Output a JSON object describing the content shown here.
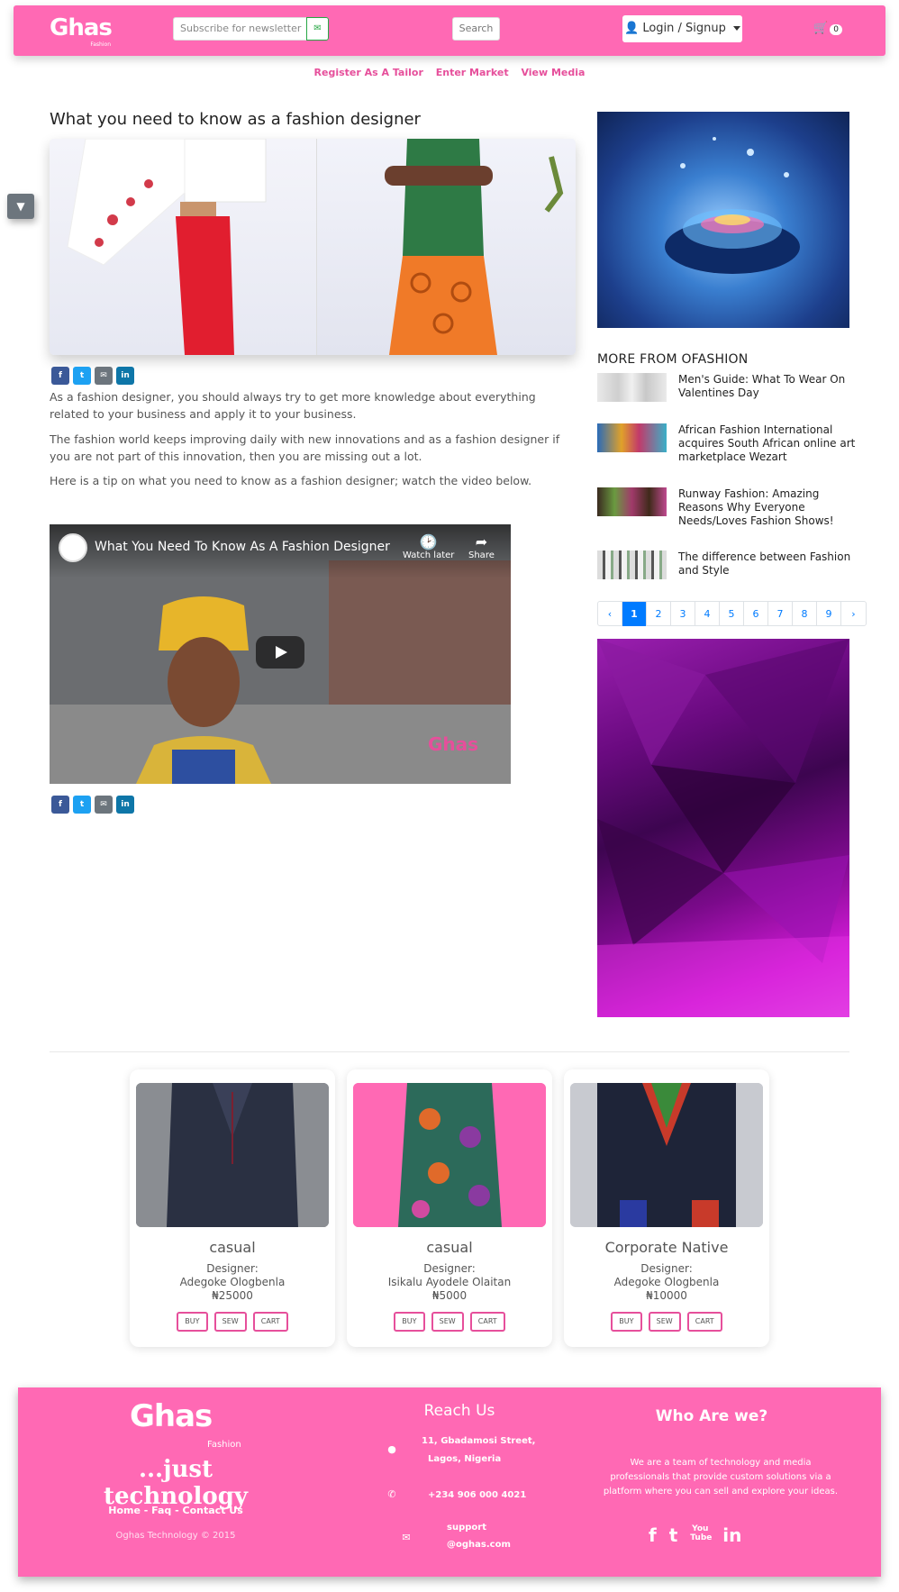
{
  "header": {
    "logo": "Ghas",
    "logo_sub": "Fashion",
    "newsletter_placeholder": "Subscribe for newsletter",
    "newsletter_icon": "envelope-icon",
    "search_label": "Search",
    "login_label": "Login / Signup",
    "cart_count": "0"
  },
  "topnav": [
    "Register As A Tailor",
    "Enter Market",
    "View Media"
  ],
  "article": {
    "title": "What you need to know as a fashion designer",
    "share": [
      "f",
      "t",
      "✉",
      "in"
    ],
    "paragraphs": [
      "As a fashion designer, you should always try to get more knowledge about everything related to your business and apply it to your business.",
      "The fashion world keeps improving daily with new innovations and as a fashion designer if you are not part of this innovation, then you are missing out a lot.",
      "Here is a tip on what you need to know as a fashion designer; watch the video below."
    ],
    "video": {
      "title": "What You Need To Know As A Fashion Designer",
      "watch_later": "Watch later",
      "share": "Share",
      "watermark": "Ghas"
    }
  },
  "sidebar": {
    "more_title": "MORE FROM OFASHION",
    "items": [
      "Men's Guide: What To Wear On Valentines Day",
      "African Fashion International acquires South African online art marketplace Wezart",
      "Runway Fashion: Amazing Reasons Why Everyone Needs/Loves Fashion Shows!",
      "The difference between Fashion and Style"
    ],
    "pager": [
      "‹",
      "1",
      "2",
      "3",
      "4",
      "5",
      "6",
      "7",
      "8",
      "9",
      "›"
    ],
    "pager_active": "1"
  },
  "products": [
    {
      "name": "casual",
      "designer_label": "Designer:",
      "designer": "Adegoke Ologbenla",
      "price": "₦25000"
    },
    {
      "name": "casual",
      "designer_label": "Designer:",
      "designer": "Isikalu Ayodele Olaitan",
      "price": "₦5000"
    },
    {
      "name": "Corporate Native",
      "designer_label": "Designer:",
      "designer": "Adegoke Ologbenla",
      "price": "₦10000"
    }
  ],
  "product_buttons": [
    "BUY",
    "SEW",
    "CART"
  ],
  "footer": {
    "logo": "Ghas",
    "logo_sub": "Fashion",
    "tagline": "...just technology",
    "links": "Home - Faq - Contact Us",
    "copyright": "Oghas Technology © 2015",
    "reach_title": "Reach Us",
    "address_line1": "11, Gbadamosi Street,",
    "address_line2": "Lagos, Nigeria",
    "phone": "+234 906 000 4021",
    "email_line1": "support",
    "email_line2": "@oghas.com",
    "who_title": "Who Are we?",
    "who_text": "We are a team of technology and media professionals that provide custom solutions via a platform where you can sell and explore your ideas.",
    "social": [
      "f",
      "t",
      "You Tube",
      "in"
    ]
  },
  "colors": {
    "brand_pink": "#ff69b4",
    "link_pink": "#e64f9b",
    "pager_blue": "#007bff"
  }
}
